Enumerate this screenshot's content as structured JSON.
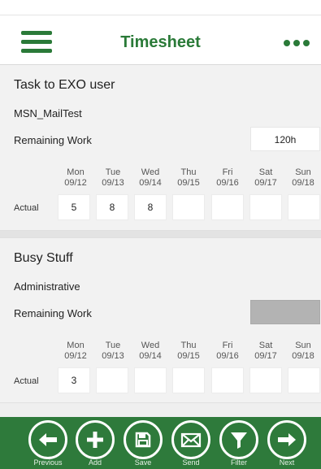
{
  "header": {
    "title": "Timesheet"
  },
  "days": [
    {
      "day": "Mon",
      "date": "09/12"
    },
    {
      "day": "Tue",
      "date": "09/13"
    },
    {
      "day": "Wed",
      "date": "09/14"
    },
    {
      "day": "Thu",
      "date": "09/15"
    },
    {
      "day": "Fri",
      "date": "09/16"
    },
    {
      "day": "Sat",
      "date": "09/17"
    },
    {
      "day": "Sun",
      "date": "09/18"
    }
  ],
  "tasks": [
    {
      "name": "Task to EXO user",
      "project": "MSN_MailTest",
      "remaining_label": "Remaining Work",
      "remaining_value": "120h",
      "actual_label": "Actual",
      "actuals": [
        "5",
        "8",
        "8",
        "",
        "",
        "",
        ""
      ]
    },
    {
      "name": "Busy Stuff",
      "project": "Administrative",
      "remaining_label": "Remaining Work",
      "remaining_value": "",
      "actual_label": "Actual",
      "actuals": [
        "3",
        "",
        "",
        "",
        "",
        "",
        ""
      ]
    }
  ],
  "toolbar": {
    "previous": "Previous",
    "add": "Add",
    "save": "Save",
    "send": "Send",
    "filter": "Filter",
    "next": "Next"
  },
  "colors": {
    "brand": "#2e7a3b",
    "disabled": "#b3b3b3"
  }
}
